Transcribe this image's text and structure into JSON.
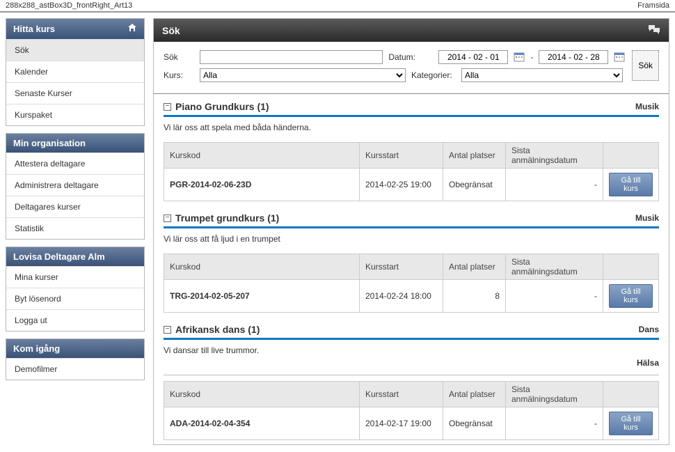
{
  "top": {
    "left": "288x288_astBox3D_frontRight_Art13",
    "right": "Framsida"
  },
  "sidebar": {
    "groups": [
      {
        "title": "Hitta kurs",
        "icon": "home-icon",
        "items": [
          {
            "label": "Sök",
            "active": true
          },
          {
            "label": "Kalender"
          },
          {
            "label": "Senaste Kurser"
          },
          {
            "label": "Kurspaket"
          }
        ]
      },
      {
        "title": "Min organisation",
        "items": [
          {
            "label": "Attestera deltagare"
          },
          {
            "label": "Administrera deltagare"
          },
          {
            "label": "Deltagares kurser"
          },
          {
            "label": "Statistik"
          }
        ]
      },
      {
        "title": "Lovisa Deltagare Alm",
        "items": [
          {
            "label": "Mina kurser"
          },
          {
            "label": "Byt lösenord"
          },
          {
            "label": "Logga ut"
          }
        ]
      },
      {
        "title": "Kom igång",
        "items": [
          {
            "label": "Demofilmer"
          }
        ]
      }
    ]
  },
  "mainHeader": {
    "title": "Sök"
  },
  "search": {
    "labels": {
      "sok": "Sök",
      "datum": "Datum:",
      "kurs": "Kurs:",
      "kategorier": "Kategorier:"
    },
    "values": {
      "sok": "",
      "dateFrom": "2014 - 02 - 01",
      "dateTo": "2014 - 02 - 28",
      "kurs": "Alla",
      "kategori": "Alla"
    },
    "dash": "-",
    "button": "Sök"
  },
  "table": {
    "headers": {
      "kurskod": "Kurskod",
      "kursstart": "Kursstart",
      "platser": "Antal platser",
      "sista": "Sista anmälningsdatum"
    },
    "goBtn": "Gå till kurs",
    "dash": "-"
  },
  "courses": [
    {
      "title": "Piano Grundkurs (1)",
      "category": "Musik",
      "desc": "Vi lär oss att spela med båda händerna.",
      "rows": [
        {
          "kod": "PGR-2014-02-06-23D",
          "start": "2014-02-25 19:00",
          "platser": "Obegränsat",
          "sista": "-"
        }
      ]
    },
    {
      "title": "Trumpet grundkurs (1)",
      "category": "Musik",
      "desc": "Vi lär oss att få ljud i en trumpet",
      "rows": [
        {
          "kod": "TRG-2014-02-05-207",
          "start": "2014-02-24 18:00",
          "platser": "8",
          "sista": "-"
        }
      ]
    },
    {
      "title": "Afrikansk dans (1)",
      "category": "Dans",
      "desc": "Vi dansar till live trummor.",
      "extraCategory": "Hälsa",
      "rows": [
        {
          "kod": "ADA-2014-02-04-354",
          "start": "2014-02-17 19:00",
          "platser": "Obegränsat",
          "sista": "-"
        }
      ]
    }
  ]
}
